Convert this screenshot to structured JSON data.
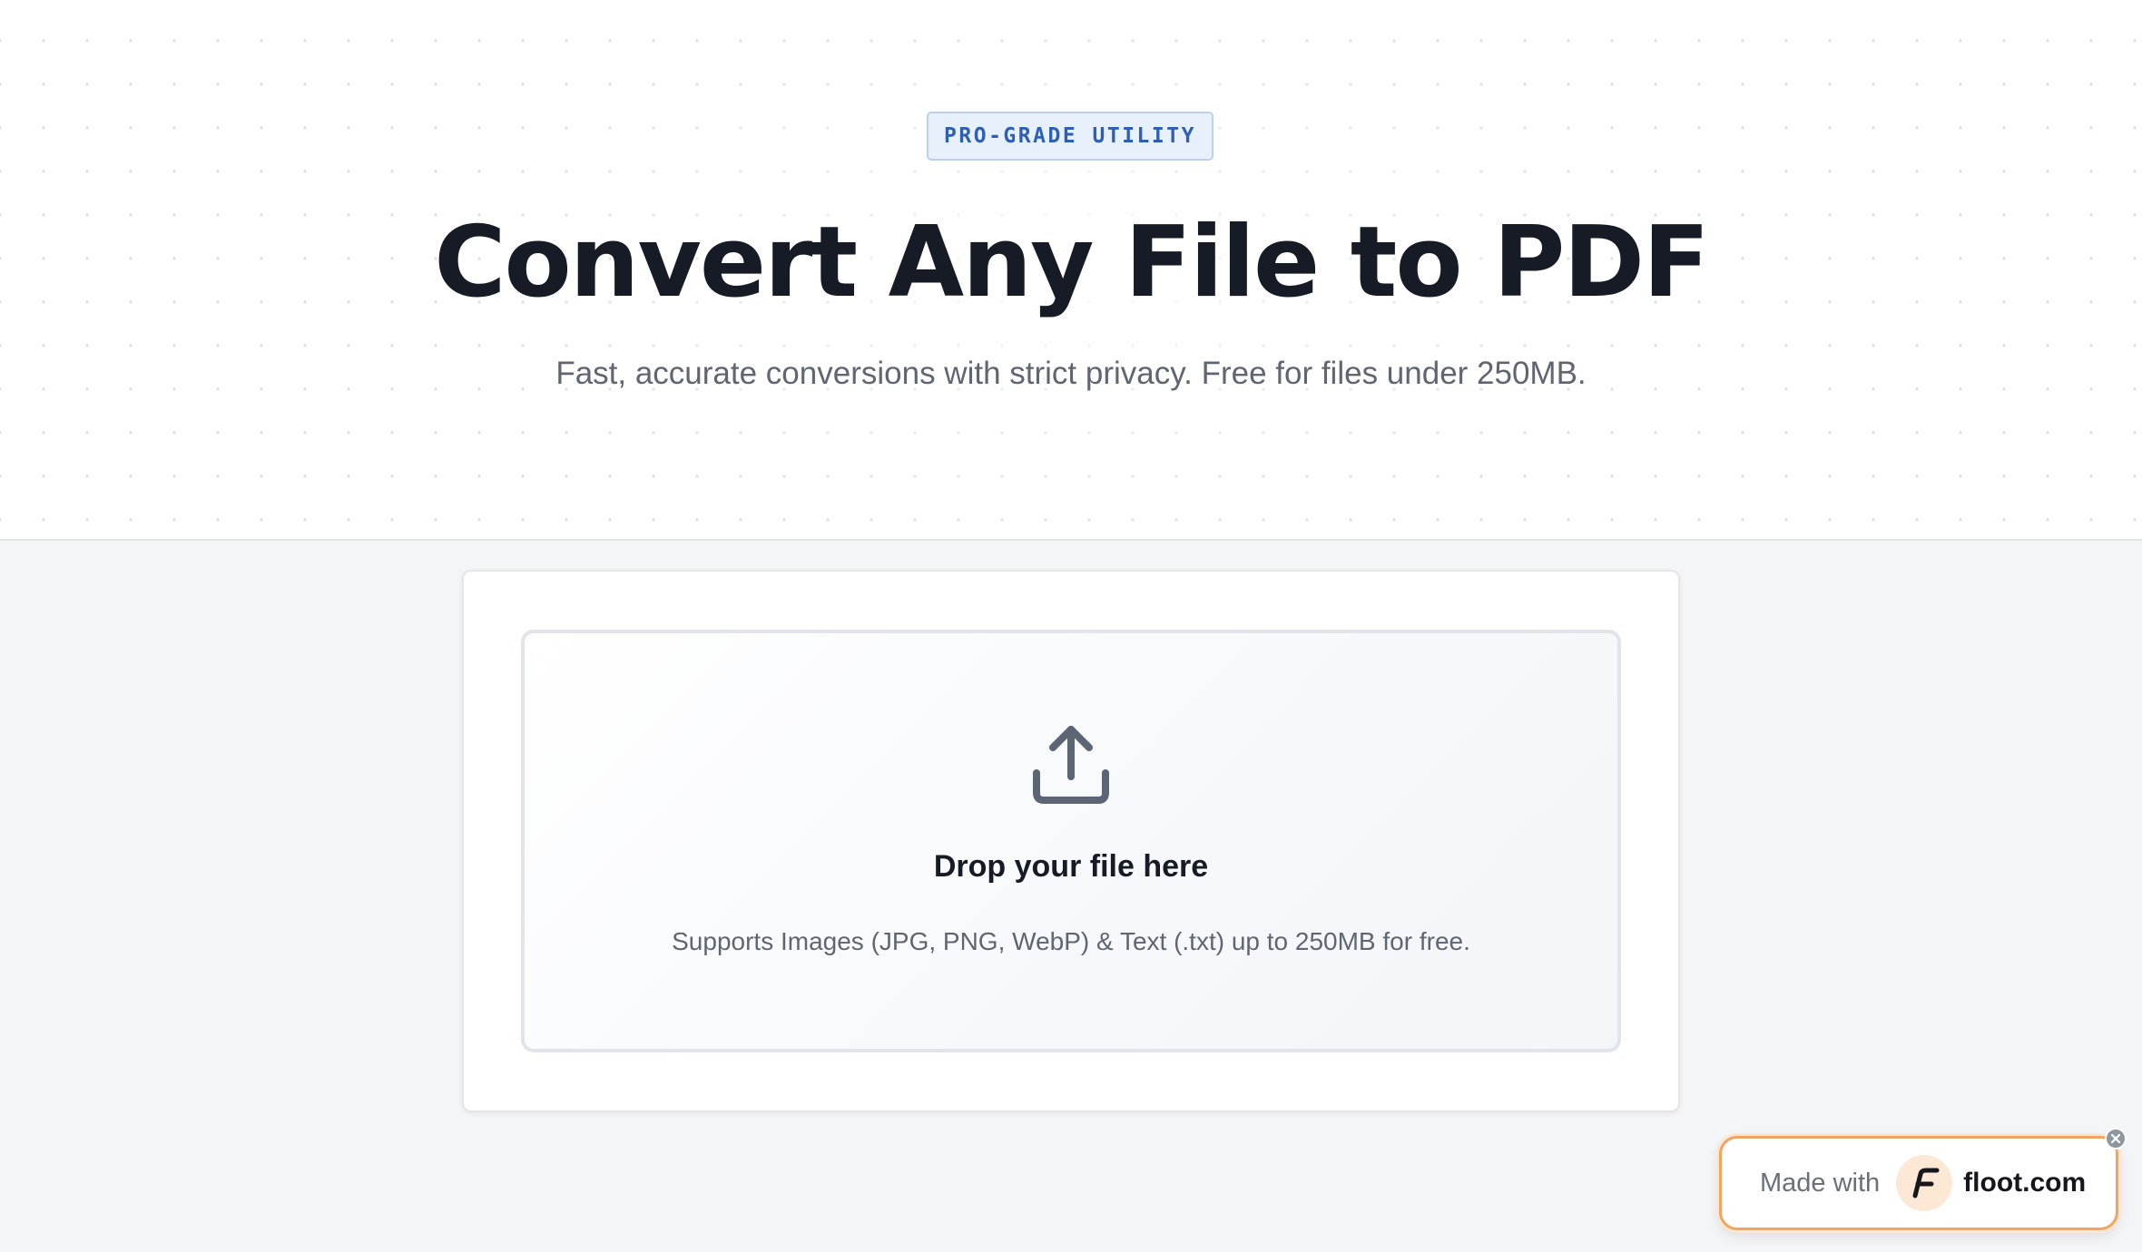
{
  "hero": {
    "badge": "PRO-GRADE UTILITY",
    "title": "Convert Any File to PDF",
    "subtitle": "Fast, accurate conversions with strict privacy. Free for files under 250MB."
  },
  "dropzone": {
    "icon": "upload-icon",
    "title": "Drop your file here",
    "hint": "Supports Images (JPG, PNG, WebP) & Text (.txt) up to 250MB for free."
  },
  "floot": {
    "made_with": "Made with",
    "domain": "floot.com",
    "logo_icon": "floot-logo-icon",
    "close_icon": "close-icon"
  },
  "colors": {
    "accent_blue": "#2d5fb5",
    "badge_bg": "#e8f0fc",
    "title_text": "#161b26",
    "muted_text": "#5f6672",
    "floot_orange": "#f2a462"
  }
}
